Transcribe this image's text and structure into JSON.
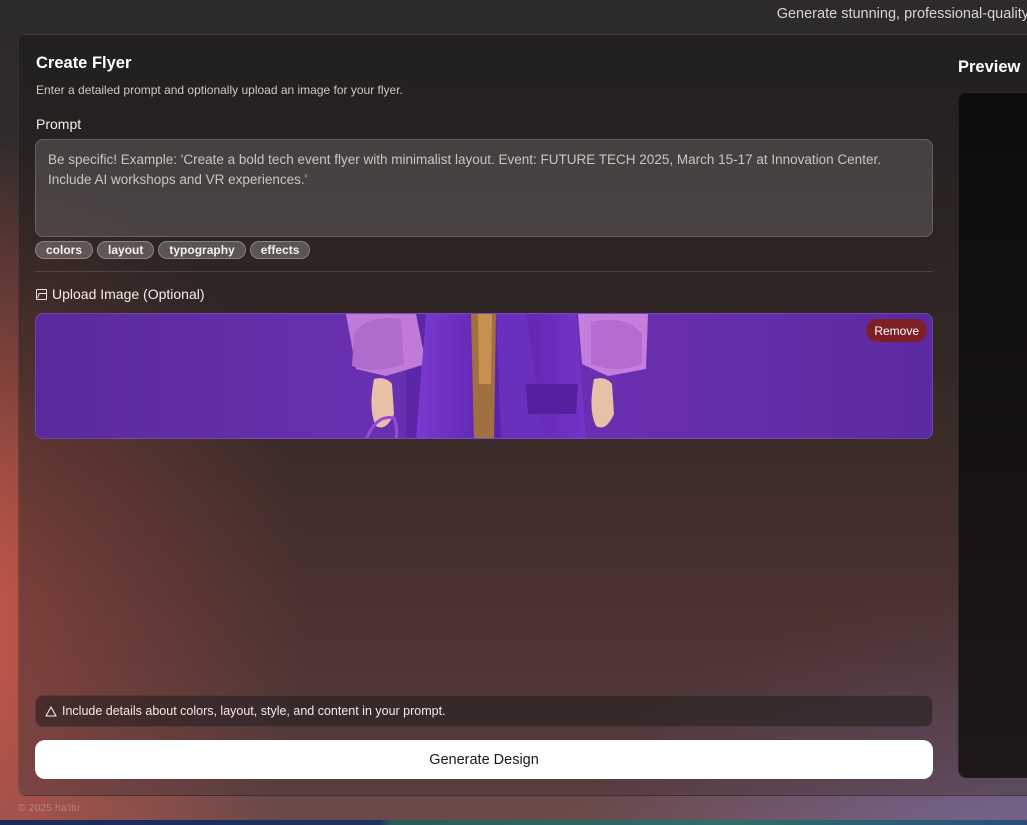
{
  "header": {
    "tagline": "Generate stunning, professional-quality"
  },
  "form": {
    "title": "Create Flyer",
    "subtitle": "Enter a detailed prompt and optionally upload an image for your flyer.",
    "prompt_label": "Prompt",
    "prompt_placeholder": "Be specific! Example: 'Create a bold tech event flyer with minimalist layout. Event: FUTURE TECH 2025, March 15-17 at Innovation Center. Include AI workshops and VR experiences.'",
    "chips": [
      "colors",
      "layout",
      "typography",
      "effects"
    ],
    "upload_label": "Upload Image (Optional)",
    "remove_label": "Remove",
    "tip": "Include details about colors, layout, style, and content in your prompt.",
    "generate_label": "Generate Design"
  },
  "preview": {
    "title": "Preview"
  },
  "footer": {
    "copyright": "© 2025 ha'itu"
  },
  "icons": {
    "upload": "image-icon",
    "tip": "warning-triangle-icon"
  },
  "colors": {
    "remove_bg": "#7c1f27",
    "image_purple": "#6830b0",
    "button_bg": "#ffffff"
  }
}
